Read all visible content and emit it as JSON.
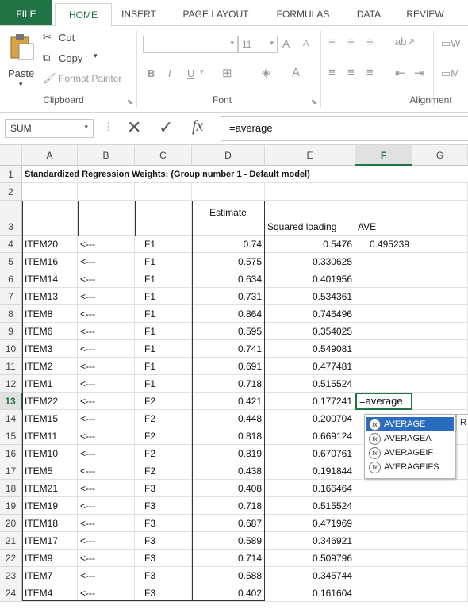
{
  "tabs": [
    "FILE",
    "HOME",
    "INSERT",
    "PAGE LAYOUT",
    "FORMULAS",
    "DATA",
    "REVIEW"
  ],
  "ribbon": {
    "clipboard": {
      "paste": "Paste",
      "cut": "Cut",
      "copy": "Copy",
      "format_painter": "Format Painter",
      "label": "Clipboard"
    },
    "font": {
      "size": "11",
      "bold": "B",
      "italic": "I",
      "underline": "U",
      "label": "Font",
      "grow": "A",
      "shrink": "A",
      "color": "A"
    },
    "alignment": {
      "label": "Alignment",
      "wrap": "W",
      "merge": "M"
    }
  },
  "formula_bar": {
    "name_box": "SUM",
    "fx": "fx",
    "formula": "=average"
  },
  "columns": [
    "A",
    "B",
    "C",
    "D",
    "E",
    "F",
    "G"
  ],
  "selected": {
    "column": "F",
    "row": "13"
  },
  "rows": [
    {
      "n": "1",
      "a": "Standardized Regression Weights: (Group number 1 - Default model)",
      "b": "",
      "c": "",
      "d": "",
      "e": "",
      "f": ""
    },
    {
      "n": "2",
      "a": "",
      "b": "",
      "c": "",
      "d": "",
      "e": "",
      "f": ""
    },
    {
      "n": "3",
      "a": "",
      "b": "",
      "c": "",
      "d": "Estimate",
      "e": "Squared loading",
      "f": "AVE"
    },
    {
      "n": "4",
      "a": "ITEM20",
      "b": "<---",
      "c": "F1",
      "d": "0.74",
      "e": "0.5476",
      "f": "0.495239"
    },
    {
      "n": "5",
      "a": "ITEM16",
      "b": "<---",
      "c": "F1",
      "d": "0.575",
      "e": "0.330625",
      "f": ""
    },
    {
      "n": "6",
      "a": "ITEM14",
      "b": "<---",
      "c": "F1",
      "d": "0.634",
      "e": "0.401956",
      "f": ""
    },
    {
      "n": "7",
      "a": "ITEM13",
      "b": "<---",
      "c": "F1",
      "d": "0.731",
      "e": "0.534361",
      "f": ""
    },
    {
      "n": "8",
      "a": "ITEM8",
      "b": "<---",
      "c": "F1",
      "d": "0.864",
      "e": "0.746496",
      "f": ""
    },
    {
      "n": "9",
      "a": "ITEM6",
      "b": "<---",
      "c": "F1",
      "d": "0.595",
      "e": "0.354025",
      "f": ""
    },
    {
      "n": "10",
      "a": "ITEM3",
      "b": "<---",
      "c": "F1",
      "d": "0.741",
      "e": "0.549081",
      "f": ""
    },
    {
      "n": "11",
      "a": "ITEM2",
      "b": "<---",
      "c": "F1",
      "d": "0.691",
      "e": "0.477481",
      "f": ""
    },
    {
      "n": "12",
      "a": "ITEM1",
      "b": "<---",
      "c": "F1",
      "d": "0.718",
      "e": "0.515524",
      "f": ""
    },
    {
      "n": "13",
      "a": "ITEM22",
      "b": "<---",
      "c": "F2",
      "d": "0.421",
      "e": "0.177241",
      "f": "=average"
    },
    {
      "n": "14",
      "a": "ITEM15",
      "b": "<---",
      "c": "F2",
      "d": "0.448",
      "e": "0.200704",
      "f": ""
    },
    {
      "n": "15",
      "a": "ITEM11",
      "b": "<---",
      "c": "F2",
      "d": "0.818",
      "e": "0.669124",
      "f": ""
    },
    {
      "n": "16",
      "a": "ITEM10",
      "b": "<---",
      "c": "F2",
      "d": "0.819",
      "e": "0.670761",
      "f": ""
    },
    {
      "n": "17",
      "a": "ITEM5",
      "b": "<---",
      "c": "F2",
      "d": "0.438",
      "e": "0.191844",
      "f": ""
    },
    {
      "n": "18",
      "a": "ITEM21",
      "b": "<---",
      "c": "F3",
      "d": "0.408",
      "e": "0.166464",
      "f": ""
    },
    {
      "n": "19",
      "a": "ITEM19",
      "b": "<---",
      "c": "F3",
      "d": "0.718",
      "e": "0.515524",
      "f": ""
    },
    {
      "n": "20",
      "a": "ITEM18",
      "b": "<---",
      "c": "F3",
      "d": "0.687",
      "e": "0.471969",
      "f": ""
    },
    {
      "n": "21",
      "a": "ITEM17",
      "b": "<---",
      "c": "F3",
      "d": "0.589",
      "e": "0.346921",
      "f": ""
    },
    {
      "n": "22",
      "a": "ITEM9",
      "b": "<---",
      "c": "F3",
      "d": "0.714",
      "e": "0.509796",
      "f": ""
    },
    {
      "n": "23",
      "a": "ITEM7",
      "b": "<---",
      "c": "F3",
      "d": "0.588",
      "e": "0.345744",
      "f": ""
    },
    {
      "n": "24",
      "a": "ITEM4",
      "b": "<---",
      "c": "F3",
      "d": "0.402",
      "e": "0.161604",
      "f": ""
    }
  ],
  "autocomplete": {
    "items": [
      "AVERAGE",
      "AVERAGEA",
      "AVERAGEIF",
      "AVERAGEIFS"
    ],
    "highlighted": "AVERAGE",
    "tooltip_stub": "R"
  },
  "colors": {
    "accent": "#217346",
    "highlight": "#2a6dc0"
  }
}
